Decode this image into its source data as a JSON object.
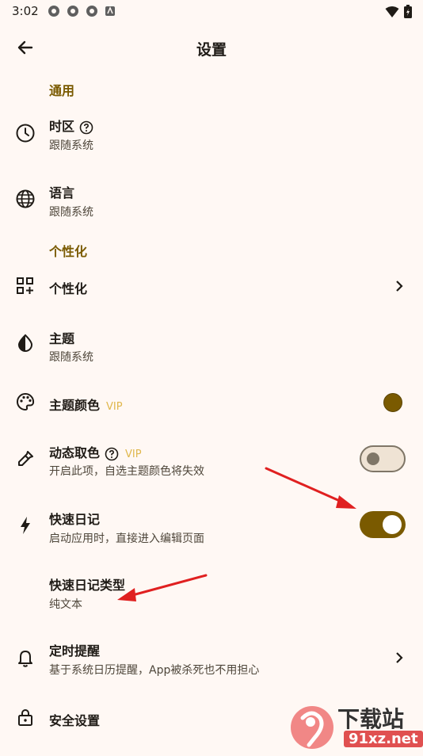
{
  "status_bar": {
    "time": "3:02"
  },
  "header": {
    "title": "设置"
  },
  "sections": {
    "general": "通用",
    "personalize": "个性化"
  },
  "rows": {
    "timezone": {
      "label": "时区",
      "sub": "跟随系统"
    },
    "language": {
      "label": "语言",
      "sub": "跟随系统"
    },
    "personalize": {
      "label": "个性化"
    },
    "theme": {
      "label": "主题",
      "sub": "跟随系统"
    },
    "theme_color": {
      "label": "主题颜色",
      "badge": "VIP",
      "color": "#7a5a00"
    },
    "dynamic_color": {
      "label": "动态取色",
      "badge": "VIP",
      "sub": "开启此项，自选主题颜色将失效",
      "enabled": false
    },
    "quick_diary": {
      "label": "快速日记",
      "sub": "启动应用时，直接进入编辑页面",
      "enabled": true
    },
    "quick_diary_type": {
      "label": "快速日记类型",
      "sub": "纯文本"
    },
    "reminder": {
      "label": "定时提醒",
      "sub": "基于系统日历提醒，App被杀死也不用担心"
    },
    "security": {
      "label": "安全设置"
    }
  },
  "watermark": {
    "text": "下载站",
    "url_text": "91xz.net"
  },
  "colors": {
    "accent": "#7a5a00",
    "background": "#fff8f4",
    "annotation_arrow": "#e02020"
  }
}
